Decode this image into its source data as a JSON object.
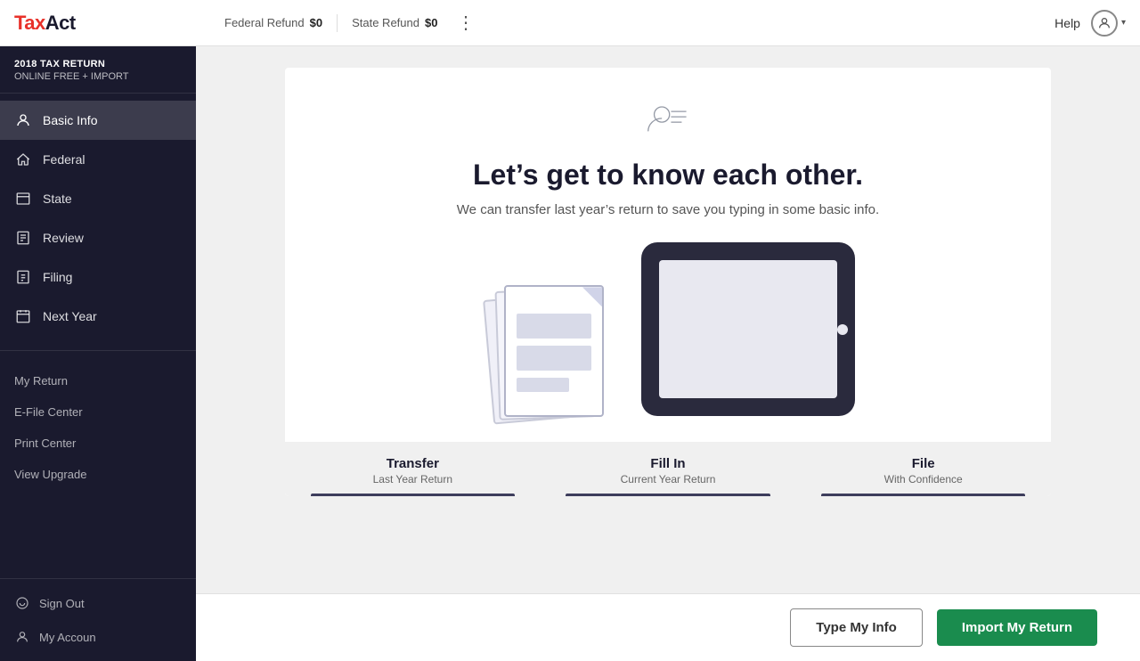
{
  "topbar": {
    "logo_tax": "Tax",
    "logo_act": "Act",
    "federal_refund_label": "Federal Refund",
    "federal_refund_value": "$0",
    "state_refund_label": "State Refund",
    "state_refund_value": "$0",
    "help_label": "Help"
  },
  "sidebar": {
    "brand_title": "2018 TAX RETURN",
    "brand_sub": "ONLINE FREE + IMPORT",
    "nav_items": [
      {
        "id": "basic-info",
        "label": "Basic Info",
        "active": true
      },
      {
        "id": "federal",
        "label": "Federal",
        "active": false
      },
      {
        "id": "state",
        "label": "State",
        "active": false
      },
      {
        "id": "review",
        "label": "Review",
        "active": false
      },
      {
        "id": "filing",
        "label": "Filing",
        "active": false
      },
      {
        "id": "next-year",
        "label": "Next Year",
        "active": false
      }
    ],
    "secondary_items": [
      {
        "id": "my-return",
        "label": "My Return"
      },
      {
        "id": "e-file-center",
        "label": "E-File Center"
      },
      {
        "id": "print-center",
        "label": "Print Center"
      },
      {
        "id": "view-upgrade",
        "label": "View Upgrade"
      }
    ],
    "bottom_items": [
      {
        "id": "sign-out",
        "label": "Sign Out"
      },
      {
        "id": "my-account",
        "label": "My Accoun"
      }
    ]
  },
  "main": {
    "icon_label": "person-with-lines-icon",
    "title": "Let’s get to know each other.",
    "subtitle": "We can transfer last year’s return to save you typing in some basic info.",
    "steps": [
      {
        "title": "Transfer",
        "sub": "Last Year Return"
      },
      {
        "title": "Fill In",
        "sub": "Current Year Return"
      },
      {
        "title": "File",
        "sub": "With Confidence"
      }
    ]
  },
  "actions": {
    "type_my_info": "Type My Info",
    "import_my_return": "Import My Return"
  }
}
